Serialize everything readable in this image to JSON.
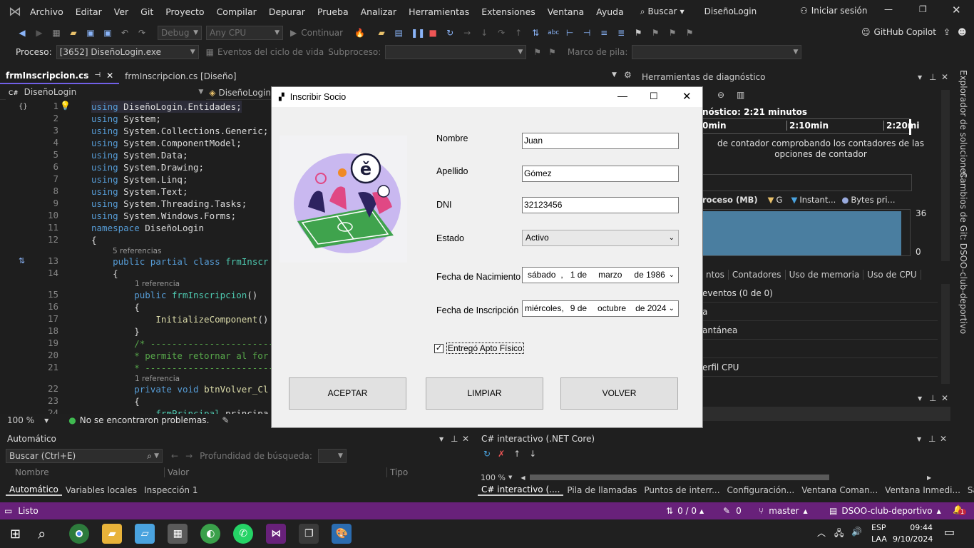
{
  "menubar": {
    "items": [
      "Archivo",
      "Editar",
      "Ver",
      "Git",
      "Proyecto",
      "Compilar",
      "Depurar",
      "Prueba",
      "Analizar",
      "Herramientas",
      "Extensiones",
      "Ventana",
      "Ayuda"
    ],
    "search_label": "Buscar",
    "solution_name": "DiseñoLogin",
    "signin_label": "Iniciar sesión"
  },
  "toolbar": {
    "config": "Debug",
    "platform": "Any CPU",
    "continue_label": "Continuar",
    "copilot_label": "GitHub Copilot",
    "process_label": "Proceso:",
    "process_value": "[3652] DiseñoLogin.exe",
    "lifecycle_label": "Eventos del ciclo de vida",
    "subprocess_label": "Subproceso:",
    "stackframe_label": "Marco de pila:"
  },
  "tabs": [
    {
      "label": "frmInscripcion.cs"
    },
    {
      "label": "frmInscripcion.cs [Diseño]"
    }
  ],
  "editor": {
    "project_nav": "DiseñoLogin",
    "class_nav": "DiseñoLogin",
    "zoom": "100 %",
    "status": "No se encontraron problemas.",
    "refs": {
      "five": "5 referencias",
      "one": "1 referencia"
    },
    "lines": [
      {
        "n": "1",
        "text": "using DiseñoLogin.Entidades;"
      },
      {
        "n": "2",
        "text": "using System;"
      },
      {
        "n": "3",
        "text": "using System.Collections.Generic;"
      },
      {
        "n": "4",
        "text": "using System.ComponentModel;"
      },
      {
        "n": "5",
        "text": "using System.Data;"
      },
      {
        "n": "6",
        "text": "using System.Drawing;"
      },
      {
        "n": "7",
        "text": "using System.Linq;"
      },
      {
        "n": "8",
        "text": "using System.Text;"
      },
      {
        "n": "9",
        "text": "using System.Threading.Tasks;"
      },
      {
        "n": "10",
        "text": "using System.Windows.Forms;"
      },
      {
        "n": "11",
        "text": "namespace DiseñoLogin"
      },
      {
        "n": "12",
        "text": "{"
      },
      {
        "n": "13",
        "text": "    public partial class frmInscr"
      },
      {
        "n": "14",
        "text": "    {"
      },
      {
        "n": "15",
        "text": "        public frmInscripcion()"
      },
      {
        "n": "16",
        "text": "        {"
      },
      {
        "n": "17",
        "text": "            InitializeComponent()"
      },
      {
        "n": "18",
        "text": "        }"
      },
      {
        "n": "19",
        "text": "        /* ---------------------------"
      },
      {
        "n": "20",
        "text": "        * permite retornar al for"
      },
      {
        "n": "21",
        "text": "        * ---------------------------"
      },
      {
        "n": "22",
        "text": "        private void btnVolver_Cl"
      },
      {
        "n": "23",
        "text": "        {"
      },
      {
        "n": "24",
        "text": "            frmPrincipal principa"
      }
    ]
  },
  "diagnostics": {
    "title": "Herramientas de diagnóstico",
    "session": "nóstico: 2:21 minutos",
    "ticks": [
      "0min",
      "2:10min",
      "2:20mi"
    ],
    "counter_msg": "de contador comprobando los contadores de las opciones de contador",
    "legend": [
      "roceso (MB)",
      "G",
      "Instant...",
      "Bytes pri..."
    ],
    "yaxis": [
      "36",
      "0"
    ],
    "tabs": [
      "ntos",
      "Contadores",
      "Uso de memoria",
      "Uso de CPU"
    ],
    "rows": [
      "eventos (0 de 0)",
      "a",
      "antánea",
      "",
      "erfil CPU"
    ]
  },
  "right_rail": {
    "solution_explorer": "Explorador de soluciones",
    "git_changes": "Cambios de Git: DSOO-club-deportivo"
  },
  "dialog": {
    "title": "Inscribir Socio",
    "labels": {
      "nombre": "Nombre",
      "apellido": "Apellido",
      "dni": "DNI",
      "estado": "Estado",
      "fecha_nac": "Fecha de Nacimiento",
      "fecha_insc": "Fecha de Inscripción"
    },
    "values": {
      "nombre": "Juan",
      "apellido": "Gómez",
      "dni": "32123456",
      "estado": "Activo"
    },
    "fecha_nac": {
      "weekday": "sábado",
      "day": "1 de",
      "month": "marzo",
      "year": "de 1986"
    },
    "fecha_insc": {
      "weekday": "miércoles,",
      "day": "9 de",
      "month": "octubre",
      "year": "de 2024"
    },
    "checkbox_label": "Entregó Apto Físico",
    "buttons": {
      "accept": "ACEPTAR",
      "clear": "LIMPIAR",
      "back": "VOLVER"
    },
    "logo_letter": "ě"
  },
  "bottom_left": {
    "title": "Automático",
    "search_placeholder": "Buscar (Ctrl+E)",
    "depth_label": "Profundidad de búsqueda:",
    "columns": [
      "Nombre",
      "Valor",
      "Tipo"
    ],
    "tabs": [
      "Automático",
      "Variables locales",
      "Inspección 1"
    ]
  },
  "bottom_right": {
    "title": "C# interactivo (.NET Core)",
    "zoom": "100 %",
    "tabs": [
      "C# interactivo (....",
      "Pila de llamadas",
      "Puntos de interr...",
      "Configuración...",
      "Ventana Coman...",
      "Ventana Inmedi...",
      "Salida"
    ]
  },
  "statusbar": {
    "ready": "Listo",
    "changes": "0 / 0",
    "pencil_count": "0",
    "branch": "master",
    "repo": "DSOO-club-deportivo",
    "notif_count": "1"
  },
  "taskbar": {
    "lang1": "ESP",
    "lang2": "LAA",
    "time": "09:44",
    "date": "9/10/2024"
  },
  "colors": {
    "accent": "#68217a",
    "vs_purple": "#7160e8",
    "keyword": "#569cd6",
    "type": "#4ec9b0",
    "comment": "#57a64a"
  }
}
